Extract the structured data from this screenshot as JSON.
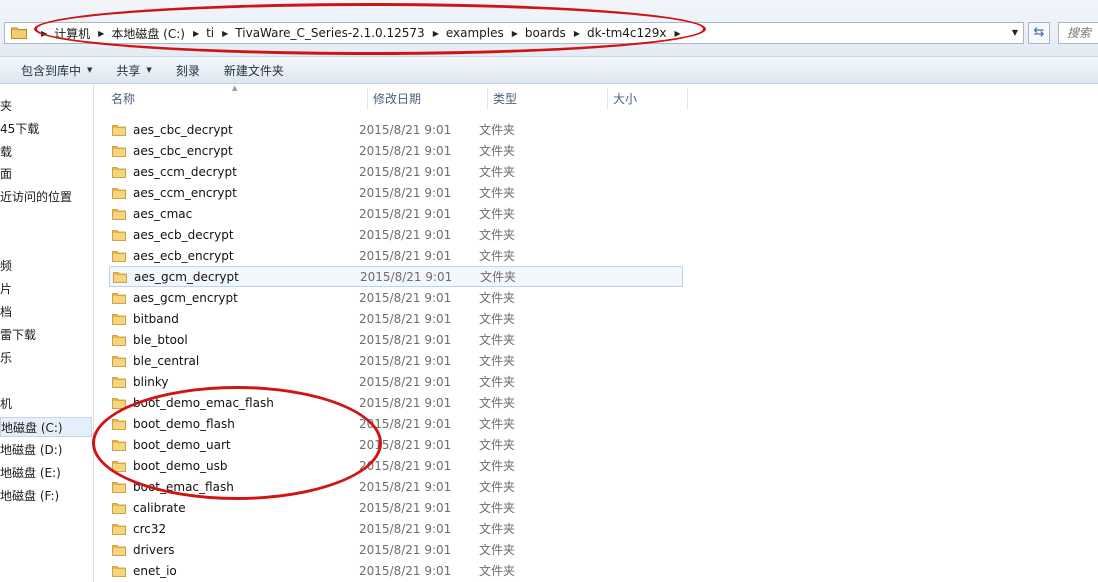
{
  "address_bar": {
    "breadcrumbs": [
      "计算机",
      "本地磁盘 (C:)",
      "ti",
      "TivaWare_C_Series-2.1.0.12573",
      "examples",
      "boards",
      "dk-tm4c129x"
    ],
    "search_placeholder": "搜索"
  },
  "toolbar": {
    "include_in_library": "包含到库中",
    "share": "共享",
    "burn": "刻录",
    "new_folder": "新建文件夹"
  },
  "nav": {
    "items": [
      "夹",
      "45下载",
      "载",
      "面",
      "近访问的位置",
      "",
      "",
      "频",
      "片",
      "档",
      "雷下载",
      "乐",
      "",
      "机",
      "地磁盘 (C:)",
      "地磁盘 (D:)",
      "地磁盘 (E:)",
      "地磁盘 (F:)"
    ],
    "selected_index": 14
  },
  "columns": {
    "name": "名称",
    "date": "修改日期",
    "type": "类型",
    "size": "大小"
  },
  "files": [
    {
      "name": "aes_cbc_decrypt",
      "date": "2015/8/21 9:01",
      "type": "文件夹"
    },
    {
      "name": "aes_cbc_encrypt",
      "date": "2015/8/21 9:01",
      "type": "文件夹"
    },
    {
      "name": "aes_ccm_decrypt",
      "date": "2015/8/21 9:01",
      "type": "文件夹"
    },
    {
      "name": "aes_ccm_encrypt",
      "date": "2015/8/21 9:01",
      "type": "文件夹"
    },
    {
      "name": "aes_cmac",
      "date": "2015/8/21 9:01",
      "type": "文件夹"
    },
    {
      "name": "aes_ecb_decrypt",
      "date": "2015/8/21 9:01",
      "type": "文件夹"
    },
    {
      "name": "aes_ecb_encrypt",
      "date": "2015/8/21 9:01",
      "type": "文件夹"
    },
    {
      "name": "aes_gcm_decrypt",
      "date": "2015/8/21 9:01",
      "type": "文件夹"
    },
    {
      "name": "aes_gcm_encrypt",
      "date": "2015/8/21 9:01",
      "type": "文件夹"
    },
    {
      "name": "bitband",
      "date": "2015/8/21 9:01",
      "type": "文件夹"
    },
    {
      "name": "ble_btool",
      "date": "2015/8/21 9:01",
      "type": "文件夹"
    },
    {
      "name": "ble_central",
      "date": "2015/8/21 9:01",
      "type": "文件夹"
    },
    {
      "name": "blinky",
      "date": "2015/8/21 9:01",
      "type": "文件夹"
    },
    {
      "name": "boot_demo_emac_flash",
      "date": "2015/8/21 9:01",
      "type": "文件夹"
    },
    {
      "name": "boot_demo_flash",
      "date": "2015/8/21 9:01",
      "type": "文件夹"
    },
    {
      "name": "boot_demo_uart",
      "date": "2015/8/21 9:01",
      "type": "文件夹"
    },
    {
      "name": "boot_demo_usb",
      "date": "2015/8/21 9:01",
      "type": "文件夹"
    },
    {
      "name": "boot_emac_flash",
      "date": "2015/8/21 9:01",
      "type": "文件夹"
    },
    {
      "name": "calibrate",
      "date": "2015/8/21 9:01",
      "type": "文件夹"
    },
    {
      "name": "crc32",
      "date": "2015/8/21 9:01",
      "type": "文件夹"
    },
    {
      "name": "drivers",
      "date": "2015/8/21 9:01",
      "type": "文件夹"
    },
    {
      "name": "enet_io",
      "date": "2015/8/21 9:01",
      "type": "文件夹"
    }
  ],
  "hovered_index": 7,
  "colors": {
    "annotation": "#d01414",
    "folder": "#e8b64a",
    "hover_border": "#b8d3f3",
    "hover_fill": "#f2f7fe"
  }
}
